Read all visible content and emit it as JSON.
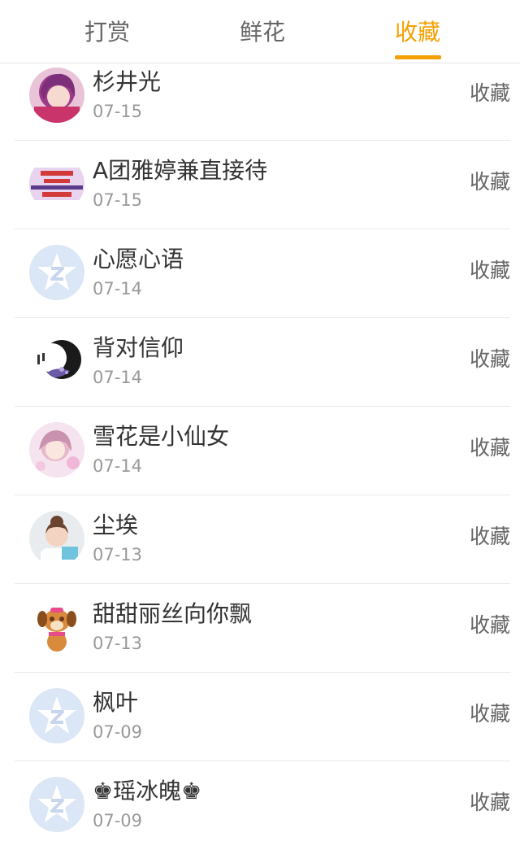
{
  "tabs": [
    {
      "label": "打赏"
    },
    {
      "label": "鲜花"
    },
    {
      "label": "收藏",
      "active": true
    }
  ],
  "colors": {
    "accent": "#f5a000",
    "text": "#333333",
    "subtext": "#999999",
    "divider": "#e9e9e9"
  },
  "list": [
    {
      "name": "杉井光",
      "date": "07-15",
      "action": "收藏",
      "avatar": "anime-girl-purple"
    },
    {
      "name": "A团雅婷兼直接待",
      "date": "07-15",
      "action": "收藏",
      "avatar": "text-banner"
    },
    {
      "name": "心愿心语",
      "date": "07-14",
      "action": "收藏",
      "avatar": "default-q-icon"
    },
    {
      "name": "背对信仰",
      "date": "07-14",
      "action": "收藏",
      "avatar": "ink-moon"
    },
    {
      "name": "雪花是小仙女",
      "date": "07-14",
      "action": "收藏",
      "avatar": "anime-girl-pink"
    },
    {
      "name": "尘埃",
      "date": "07-13",
      "action": "收藏",
      "avatar": "girl-photo"
    },
    {
      "name": "甜甜丽丝向你飘",
      "date": "07-13",
      "action": "收藏",
      "avatar": "cartoon-dog"
    },
    {
      "name": "枫叶",
      "date": "07-09",
      "action": "收藏",
      "avatar": "default-q-icon"
    },
    {
      "name": "♚瑶冰魄♚",
      "date": "07-09",
      "action": "收藏",
      "avatar": "default-q-icon"
    }
  ]
}
